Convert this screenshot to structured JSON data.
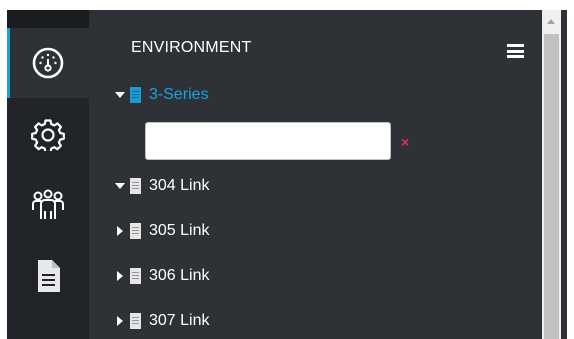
{
  "rail": {
    "items": [
      {
        "name": "dashboard",
        "icon": "dashboard-gauge-icon",
        "active": true
      },
      {
        "name": "settings",
        "icon": "gear-icon",
        "active": false
      },
      {
        "name": "users",
        "icon": "users-group-icon",
        "active": false
      },
      {
        "name": "reports",
        "icon": "document-icon",
        "active": false
      }
    ]
  },
  "panel": {
    "title": "ENVIRONMENT",
    "menu_icon": "hamburger-menu-icon"
  },
  "search": {
    "value": "",
    "placeholder": "",
    "clear_label": "×"
  },
  "tree": {
    "root": {
      "label": "3-Series",
      "expanded": true,
      "icon": "building-icon"
    },
    "items": [
      {
        "label": "304 Link",
        "expanded": true,
        "icon": "building-icon"
      },
      {
        "label": "305 Link",
        "expanded": false,
        "icon": "building-icon"
      },
      {
        "label": "306 Link",
        "expanded": false,
        "icon": "building-icon"
      },
      {
        "label": "307 Link",
        "expanded": false,
        "icon": "building-icon"
      }
    ]
  },
  "colors": {
    "accent": "#16a3e0",
    "rail_bg": "#212428",
    "panel_bg": "#2e3236",
    "clear": "#e0315b"
  }
}
